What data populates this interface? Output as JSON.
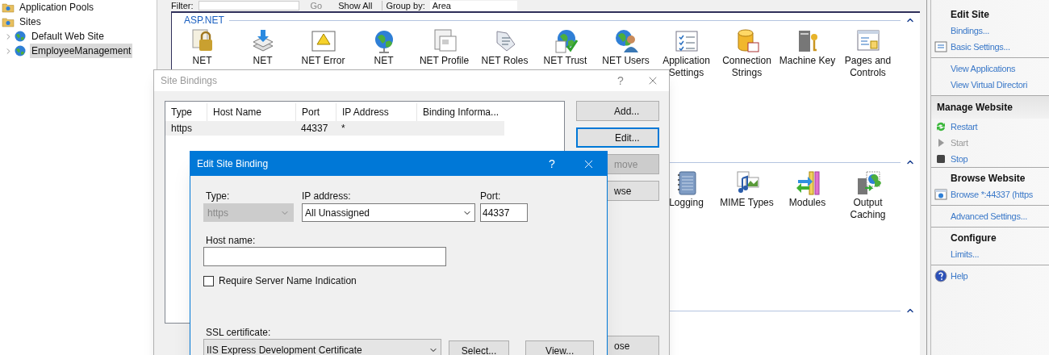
{
  "tree": [
    {
      "label": "Application Pools",
      "selected": false
    },
    {
      "label": "Sites",
      "selected": false,
      "children": [
        {
          "label": "Default Web Site",
          "selected": false,
          "expanded": false
        },
        {
          "label": "EmployeeManagement",
          "selected": true,
          "expanded": false
        }
      ]
    }
  ],
  "toolbar": {
    "filter_label": "Filter:",
    "go": "Go",
    "show_all": "Show All",
    "group_by_label": "Group by:",
    "group_by_value": "Area"
  },
  "sections": [
    {
      "title": "ASP.NET",
      "expanded": true,
      "features": [
        {
          "label": "NET"
        },
        {
          "label": "NET"
        },
        {
          "label": "NET Error"
        },
        {
          "label": "NET"
        },
        {
          "label": "NET Profile"
        },
        {
          "label": "NET Roles"
        },
        {
          "label": "NET Trust"
        },
        {
          "label": "NET Users"
        },
        {
          "label": "Application Settings"
        },
        {
          "label": "Connection Strings"
        },
        {
          "label": "Machine Key"
        },
        {
          "label": "Pages and Controls"
        }
      ]
    },
    {
      "expanded": true,
      "features": [
        {
          "label": "Logging"
        },
        {
          "label": "MIME Types"
        },
        {
          "label": "Modules"
        },
        {
          "label": "Output Caching"
        }
      ]
    },
    {
      "expanded": true
    }
  ],
  "actions": [
    {
      "kind": "section",
      "title": "Edit Site",
      "items": [
        {
          "kind": "plain",
          "label": "Bindings...",
          "disabled": false
        },
        {
          "kind": "settings",
          "label": "Basic Settings...",
          "disabled": false
        }
      ]
    },
    {
      "kind": "section",
      "items": [
        {
          "kind": "plain",
          "label": "View Applications",
          "disabled": false
        },
        {
          "kind": "plain",
          "label": "View Virtual Directori",
          "disabled": false
        }
      ]
    },
    {
      "kind": "band",
      "title": "Manage Website",
      "items": [
        {
          "kind": "restart",
          "label": "Restart",
          "disabled": false
        },
        {
          "kind": "start",
          "label": "Start",
          "disabled": true
        },
        {
          "kind": "stop",
          "label": "Stop",
          "disabled": false
        }
      ]
    },
    {
      "kind": "section",
      "title": "Browse Website",
      "items": [
        {
          "kind": "browse",
          "label": "Browse *:44337 (https",
          "disabled": false
        }
      ]
    },
    {
      "kind": "section",
      "items": [
        {
          "kind": "plain",
          "label": "Advanced Settings...",
          "disabled": false
        }
      ]
    },
    {
      "kind": "section",
      "title": "Configure",
      "items": [
        {
          "kind": "plain",
          "label": "Limits...",
          "disabled": false
        }
      ]
    },
    {
      "kind": "section",
      "items": [
        {
          "kind": "help",
          "label": "Help",
          "disabled": false
        }
      ]
    }
  ],
  "site_bindings": {
    "title": "Site Bindings",
    "help": "?",
    "columns": [
      "Type",
      "Host Name",
      "Port",
      "IP Address",
      "Binding Informa..."
    ],
    "rows": [
      {
        "type": "https",
        "port": "44337",
        "ip_address": "*",
        "selected": true
      }
    ],
    "buttons": [
      {
        "label": "Add...",
        "focused": false,
        "disabled": false
      },
      {
        "label": "Edit...",
        "focused": true,
        "disabled": false
      },
      {
        "label": "move",
        "focused": false,
        "disabled": true
      },
      {
        "label": "wse",
        "focused": false,
        "disabled": false
      }
    ],
    "close_button": "ose"
  },
  "edit_binding": {
    "title": "Edit Site Binding",
    "help": "?",
    "type": {
      "label": "Type:",
      "value": "https",
      "disabled": true
    },
    "ip_address": {
      "label": "IP address:",
      "value": "All Unassigned"
    },
    "port": {
      "label": "Port:",
      "value": "44337"
    },
    "host_name": {
      "label": "Host name:"
    },
    "sni": {
      "label": "Require Server Name Indication",
      "checked": false
    },
    "ssl_certificate": {
      "label": "SSL certificate:",
      "value": "IIS Express Development Certificate"
    },
    "buttons": [
      "Select...",
      "View..."
    ]
  }
}
